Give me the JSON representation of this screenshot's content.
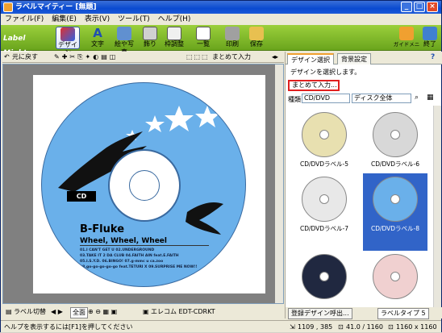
{
  "window": {
    "title": "ラベルマイティー [無題]",
    "minimize": "_",
    "maximize": "□",
    "close": "×"
  },
  "menu": [
    "ファイル(F)",
    "編集(E)",
    "表示(V)",
    "ツール(T)",
    "ヘルプ(H)"
  ],
  "ribbon": {
    "logo": "Label Mighty",
    "buttons": [
      "デザイン",
      "文字",
      "絵や写真",
      "飾り",
      "枠調整",
      "一覧",
      "印刷",
      "保存"
    ],
    "right_buttons": [
      "ガイドメニュー",
      "終了"
    ]
  },
  "toolbar2": {
    "undo": "元に戻す",
    "bulk": "まとめて入力"
  },
  "label": {
    "badge": "CD",
    "title": "B-Fluke",
    "subtitle": "Wheel, Wheel, Wheel",
    "tracks": [
      "01.I CAN'T GET U  02.UNDERGROUND",
      "03.TAKE IT 2 DA CLUB  04.FAITH AIN feat.E.FAITH",
      "05.I.S.Y.D.  06.BINGO! 07.g-mmc u ca.zoo",
      "08.go-go-go-go-go feat.TETURI X  09.SURPRISE ME NOW!!"
    ]
  },
  "left_bottom": {
    "view_switch": "ラベル切替",
    "fit": "全面",
    "printer": "エレコム EDT-CDRKT"
  },
  "right_panel": {
    "tabs": [
      "デザイン選択",
      "背景設定"
    ],
    "help": "?",
    "hint": "デザインを選択します。",
    "bulk_button": "まとめて入力...",
    "kind_label": "種類",
    "kind_value": "CD/DVD",
    "sort_value": "ディスク全体",
    "items": [
      {
        "label": "CD/DVDラベル-5",
        "color": "#e8e0b0"
      },
      {
        "label": "CD/DVDラベル-6",
        "color": "#d8d8d8"
      },
      {
        "label": "CD/DVDラベル-7",
        "color": "#e8e8e8"
      },
      {
        "label": "CD/DVDラベル-8",
        "color": "#6ab0ea"
      },
      {
        "label": "",
        "color": "#202840"
      },
      {
        "label": "",
        "color": "#f0d0d0"
      }
    ],
    "register_button": "登録デザイン呼出...",
    "counter": "ラベルタイプ 5"
  },
  "status": {
    "help_text": "ヘルプを表示するには[F1]を押してください",
    "coords": "1109 , 385",
    "size1": "41.0 / 1160",
    "size2": "1160 x 1160"
  }
}
